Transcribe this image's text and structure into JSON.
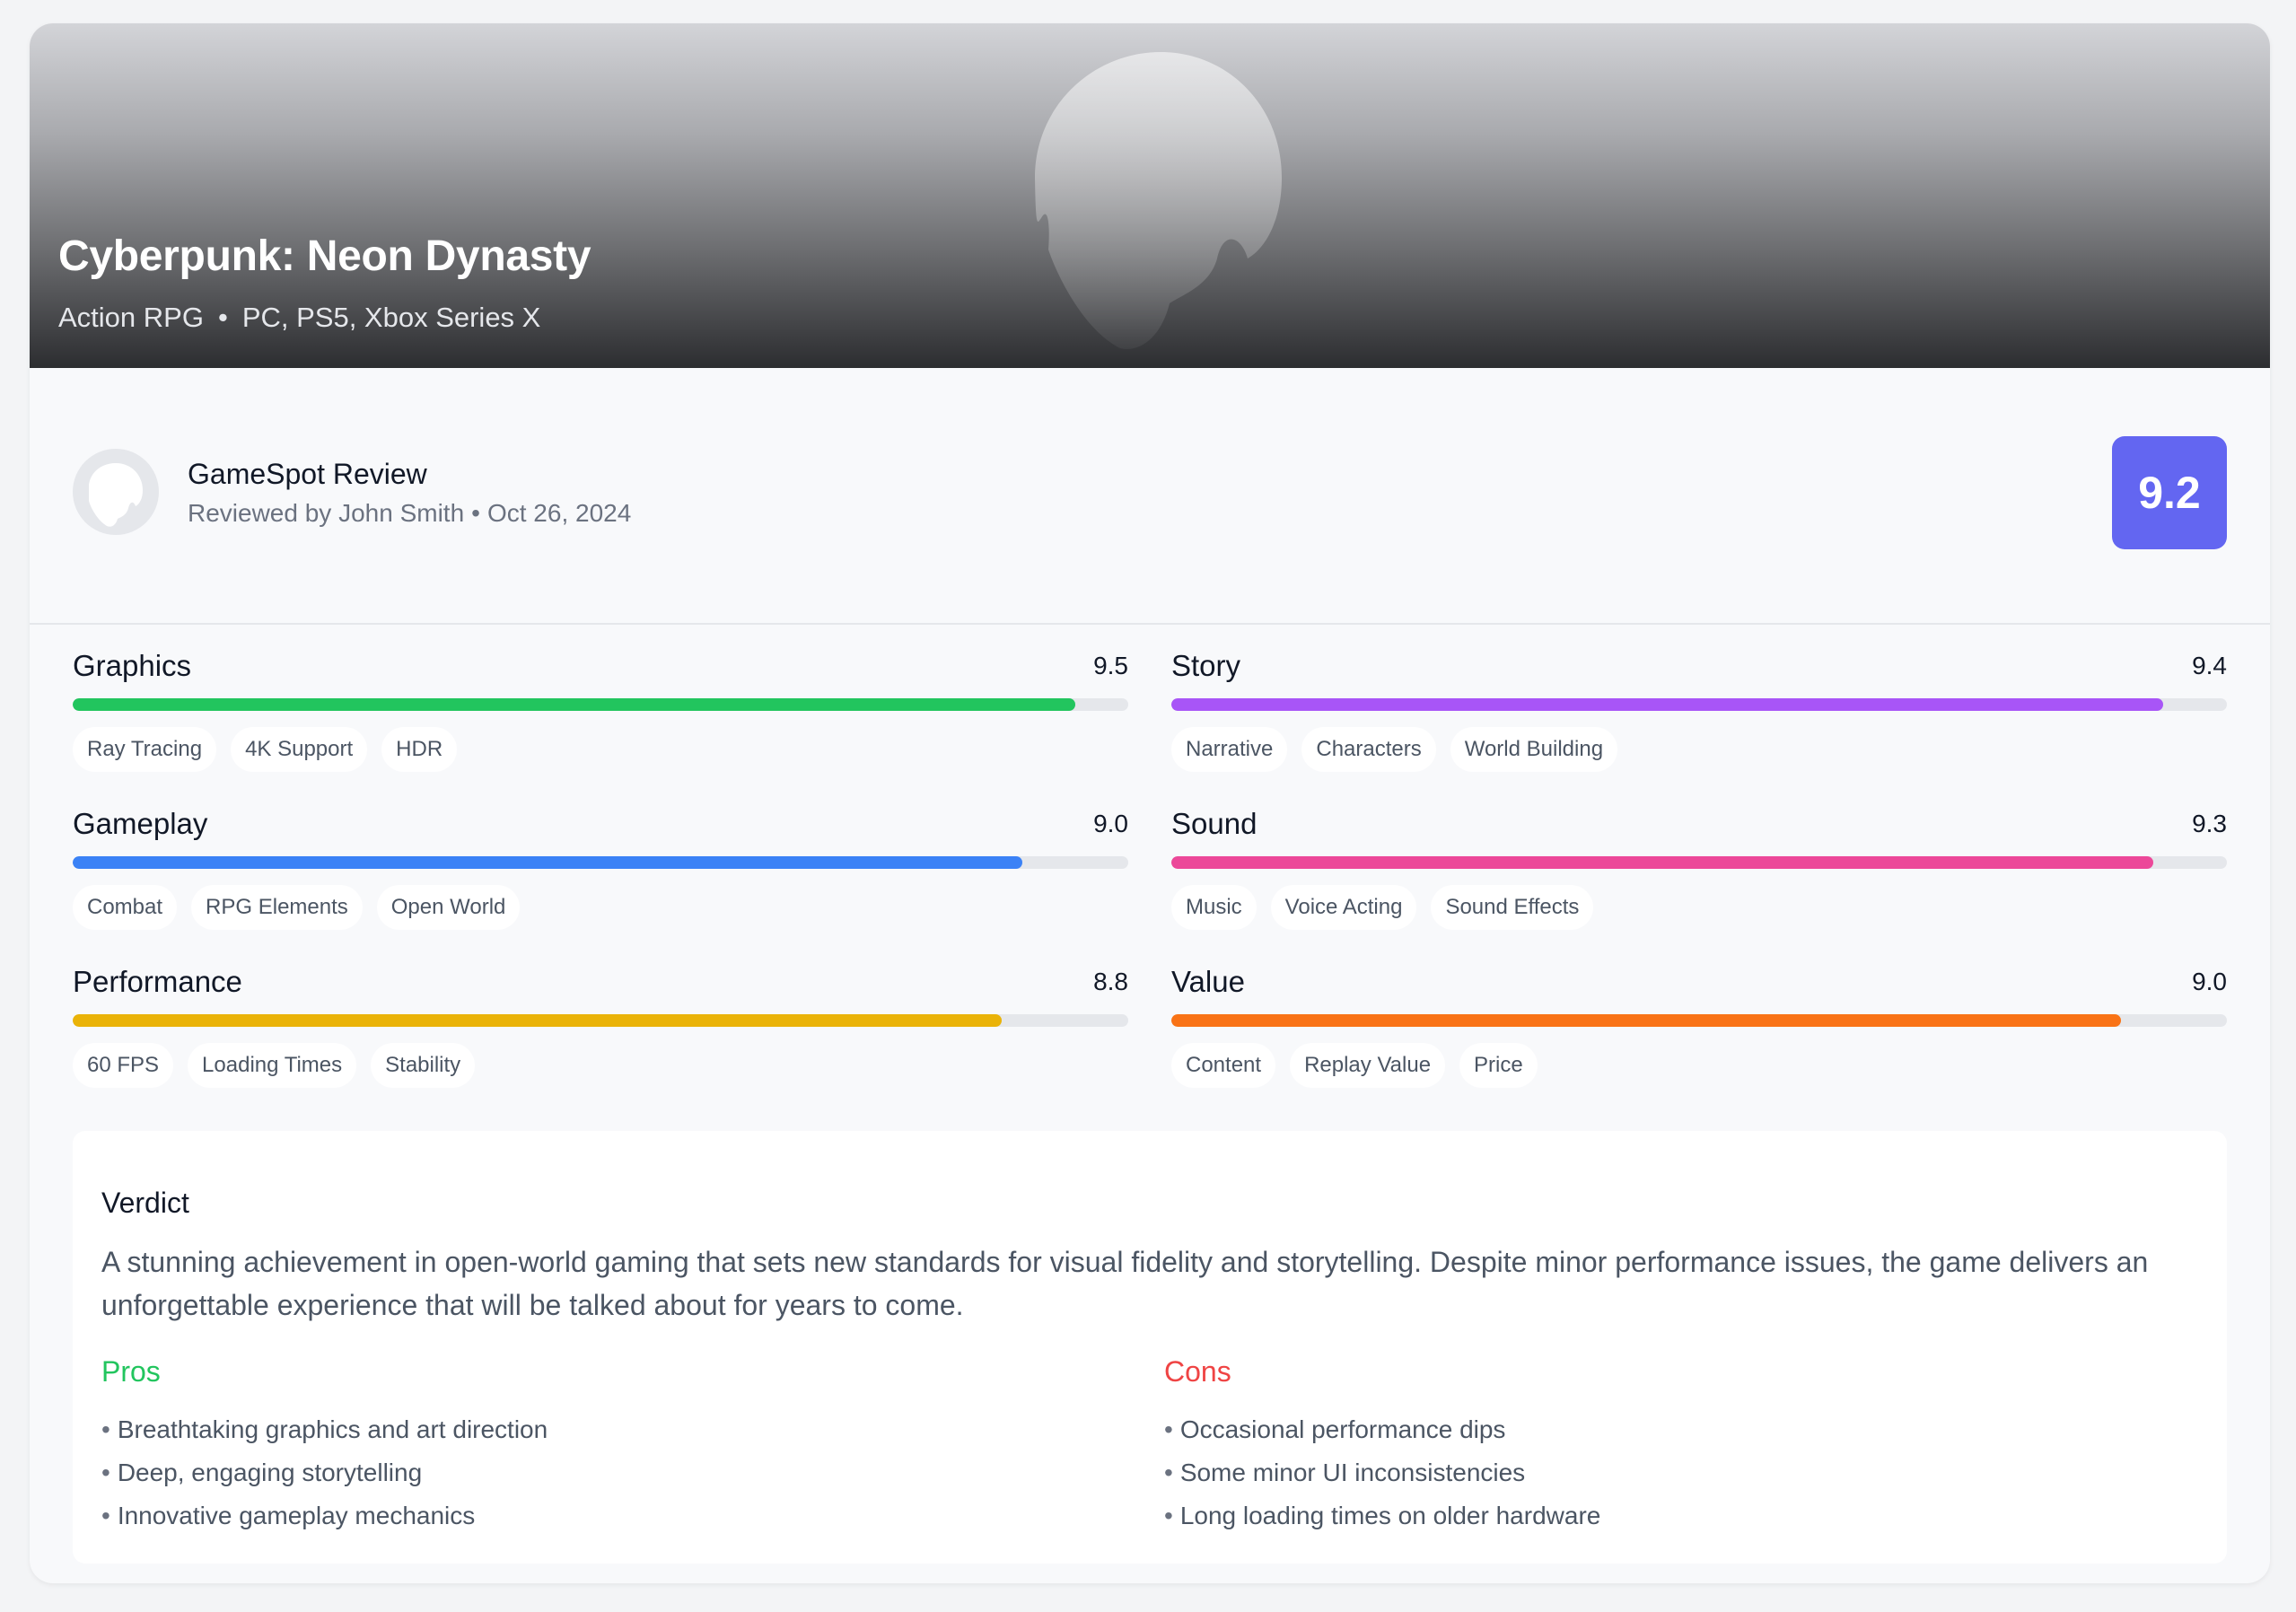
{
  "game": {
    "title": "Cyberpunk: Neon Dynasty",
    "genre": "Action RPG",
    "separator": "•",
    "platforms": "PC, PS5, Xbox Series X"
  },
  "review": {
    "source": "GameSpot Review",
    "byline": "Reviewed by John Smith",
    "separator": "•",
    "date": "Oct 26, 2024",
    "overall_score": "9.2",
    "accent_color": "#6366f1"
  },
  "categories": [
    {
      "name": "Graphics",
      "score": "9.5",
      "fill": 0.95,
      "color": "#22c55e",
      "tags": [
        "Ray Tracing",
        "4K Support",
        "HDR"
      ]
    },
    {
      "name": "Story",
      "score": "9.4",
      "fill": 0.94,
      "color": "#a855f7",
      "tags": [
        "Narrative",
        "Characters",
        "World Building"
      ]
    },
    {
      "name": "Gameplay",
      "score": "9.0",
      "fill": 0.9,
      "color": "#3b82f6",
      "tags": [
        "Combat",
        "RPG Elements",
        "Open World"
      ]
    },
    {
      "name": "Sound",
      "score": "9.3",
      "fill": 0.93,
      "color": "#ec4899",
      "tags": [
        "Music",
        "Voice Acting",
        "Sound Effects"
      ]
    },
    {
      "name": "Performance",
      "score": "8.8",
      "fill": 0.88,
      "color": "#eab308",
      "tags": [
        "60 FPS",
        "Loading Times",
        "Stability"
      ]
    },
    {
      "name": "Value",
      "score": "9.0",
      "fill": 0.9,
      "color": "#f97316",
      "tags": [
        "Content",
        "Replay Value",
        "Price"
      ]
    }
  ],
  "verdict": {
    "title": "Verdict",
    "text": "A stunning achievement in open-world gaming that sets new standards for visual fidelity and storytelling. Despite minor performance issues, the game delivers an unforgettable experience that will be talked about for years to come.",
    "pros": {
      "title": "Pros",
      "color": "#22c55e",
      "items": [
        "Breathtaking graphics and art direction",
        "Deep, engaging storytelling",
        "Innovative gameplay mechanics"
      ]
    },
    "cons": {
      "title": "Cons",
      "color": "#ef4444",
      "items": [
        "Occasional performance dips",
        "Some minor UI inconsistencies",
        "Long loading times on older hardware"
      ]
    }
  }
}
